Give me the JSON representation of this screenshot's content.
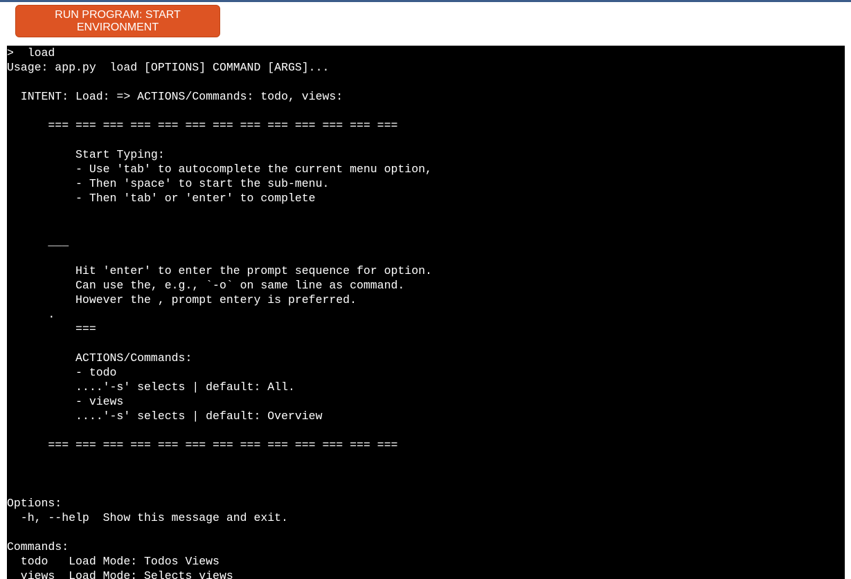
{
  "run_button": {
    "label_line1": "RUN PROGRAM: START",
    "label_line2": "ENVIRONMENT"
  },
  "terminal": {
    "output": ">  load\nUsage: app.py  load [OPTIONS] COMMAND [ARGS]...\n\n  INTENT: Load: => ACTIONS/Commands: todo, views:\n\n      === === === === === === === === === === === === ===\n\n          Start Typing:\n          - Use 'tab' to autocomplete the current menu option,\n          - Then 'space' to start the sub-menu.\n          - Then 'tab' or 'enter' to complete\n\n\n      ___\n\n          Hit 'enter' to enter the prompt sequence for option.\n          Can use the, e.g., `-o` on same line as command.\n          However the , prompt entery is preferred.\n      .\n          ===\n\n          ACTIONS/Commands:\n          - todo\n          ....'-s' selects | default: All.\n          - views\n          ....'-s' selects | default: Overview\n\n      === === === === === === === === === === === === ===\n\n\n\nOptions:\n  -h, --help  Show this message and exit.\n\nCommands:\n  todo   Load Mode: Todos Views\n  views  Load Mode: Selects views",
    "prompt": ">  "
  }
}
